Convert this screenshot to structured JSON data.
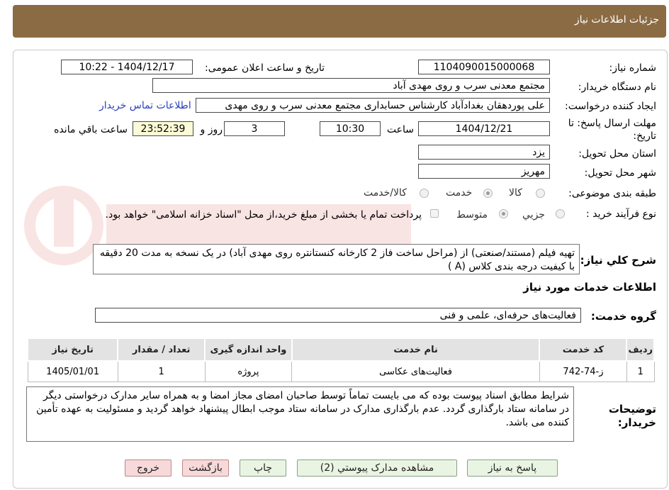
{
  "header": {
    "title": "جزئیات اطلاعات نیاز"
  },
  "form": {
    "need_number": {
      "label": "شماره نیاز:",
      "value": "1104090015000068"
    },
    "announce_datetime": {
      "label": "تاریخ و ساعت اعلان عمومی:",
      "value": "1404/12/17 - 10:22"
    },
    "buyer_org": {
      "label": "نام دستگاه خریدار:",
      "value": "مجتمع معدنی سرب و روی مهدی آباد"
    },
    "requester": {
      "label": "ایجاد کننده درخواست:",
      "value": "علی پوردهقان بغدادآباد کارشناس حسابداری مجتمع معدنی سرب و روی مهدی",
      "link": "اطلاعات تماس خریدار"
    },
    "deadline": {
      "label_line1": "مهلت ارسال پاسخ: تا",
      "label_line2": "تاریخ:",
      "date": "1404/12/21",
      "time_label": "ساعت",
      "time": "10:30",
      "days": "3",
      "days_label": "روز و",
      "remaining": "23:52:39",
      "remaining_label": "ساعت باقي مانده"
    },
    "province": {
      "label": "استان محل تحویل:",
      "value": "یزد"
    },
    "city": {
      "label": "شهر محل تحویل:",
      "value": "مهریز"
    },
    "category": {
      "label": "طبقه بندی موضوعی:",
      "options": [
        "کالا",
        "خدمت",
        "کالا/خدمت"
      ],
      "selected": "خدمت"
    },
    "process": {
      "label": "نوع فرآیند خرید :",
      "options": [
        "جزیي",
        "متوسط"
      ],
      "selected": "جزیي",
      "payment_note": "پرداخت تمام یا بخشی از مبلغ خرید،از محل \"اسناد خزانه اسلامی\" خواهد بود."
    },
    "description": {
      "label": "شرح كلي نياز:",
      "value": "تهیه فیلم (مستند/صنعتی) از (مراحل ساخت فاز 2 کارخانه کنستانتره روی مهدی آباد) در یک نسخه به  مدت 20 دقیقه با کیفیت درجه بندی  کلاس (A )"
    }
  },
  "services_section": {
    "title": "اطلاعات خدمات مورد نياز",
    "group_label": "گروه خدمت:",
    "group_value": "فعالیت‌های حرفه‌ای، علمی و فنی",
    "table": {
      "headers": [
        "ردیف",
        "کد خدمت",
        "نام خدمت",
        "واحد اندازه گیری",
        "تعداد / مقدار",
        "تاریخ نیاز"
      ],
      "rows": [
        [
          "1",
          "ز-74-742",
          "فعالیت‌های عکاسی",
          "پروژه",
          "1",
          "1405/01/01"
        ]
      ]
    }
  },
  "buyer_notes": {
    "label_line1": "توضیحات",
    "label_line2": "خریدار:",
    "value": "شرایط مطابق اسناد پیوست بوده که می بایست تماماً توسط صاحبان امضای مجاز امضا و به همراه سایر مدارک درخواستی دیگر در سامانه ستاد بارگذاری گردد. عدم بارگذاری مدارک در سامانه ستاد موجب ابطال پیشنهاد خواهد گردید و مسئولیت به عهده تأمین کننده می باشد."
  },
  "buttons": {
    "reply": "پاسخ به نياز",
    "attachments": "مشاهده مدارک پیوستي (2)",
    "print": "چاپ",
    "back": "بازگشت",
    "exit": "خروج"
  },
  "watermark_icon": "aria-tender-logo-icon",
  "colors": {
    "header": "#8b6b43",
    "button_green": "#e9f5e2",
    "button_pink": "#f7d9d9",
    "link": "#2a3fbf"
  }
}
